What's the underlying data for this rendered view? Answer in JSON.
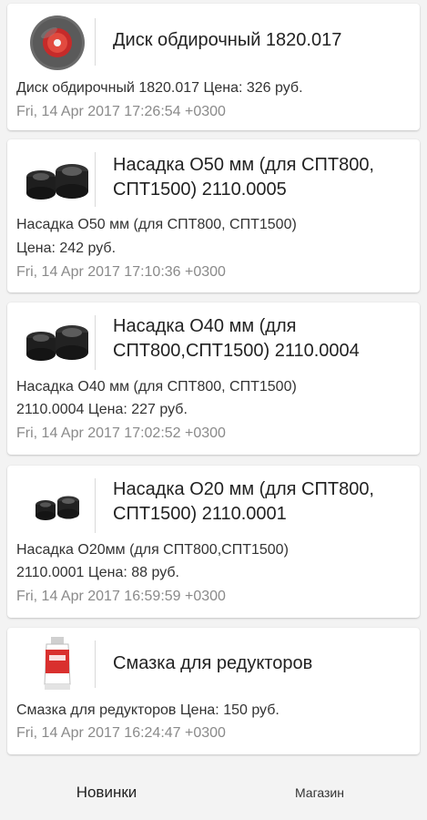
{
  "products": [
    {
      "title": "Диск обдирочный 1820.017",
      "description": "Диск обдирочный 1820.017  Цена: 326 руб.",
      "date": "Fri, 14 Apr 2017 17:26:54 +0300",
      "image_icon": "grinding-disc-icon"
    },
    {
      "title": "Насадка О50 мм (для СПТ800, СПТ1500) 2110.0005",
      "description_line1": "Насадка О50 мм (для СПТ800, СПТ1500)",
      "description_line2": "Цена: 242 руб.",
      "date": "Fri, 14 Apr 2017 17:10:36 +0300",
      "image_icon": "nozzle-pair-icon"
    },
    {
      "title": "Насадка О40 мм (для СПТ800,СПТ1500) 2110.0004",
      "description_line1": "Насадка О40 мм (для СПТ800, СПТ1500)",
      "description_line2": "2110.0004  Цена: 227 руб.",
      "date": "Fri, 14 Apr 2017 17:02:52 +0300",
      "image_icon": "nozzle-pair-icon"
    },
    {
      "title": "Насадка О20 мм (для СПТ800, СПТ1500) 2110.0001",
      "description_line1": "Насадка О20мм (для СПТ800,СПТ1500)",
      "description_line2": "2110.0001  Цена: 88 руб.",
      "date": "Fri, 14 Apr 2017 16:59:59 +0300",
      "image_icon": "nozzle-pair-small-icon"
    },
    {
      "title": "Смазка для редукторов",
      "description": "Смазка для редукторов  Цена: 150 руб.",
      "date": "Fri, 14 Apr 2017 16:24:47 +0300",
      "image_icon": "grease-tube-icon"
    }
  ],
  "bottom_nav": {
    "new_label": "Новинки",
    "shop_label": "Магазин"
  },
  "colors": {
    "background": "#f3f3f3",
    "card": "#ffffff",
    "date_text": "#8a8a8a",
    "disc_red": "#d0302f"
  }
}
